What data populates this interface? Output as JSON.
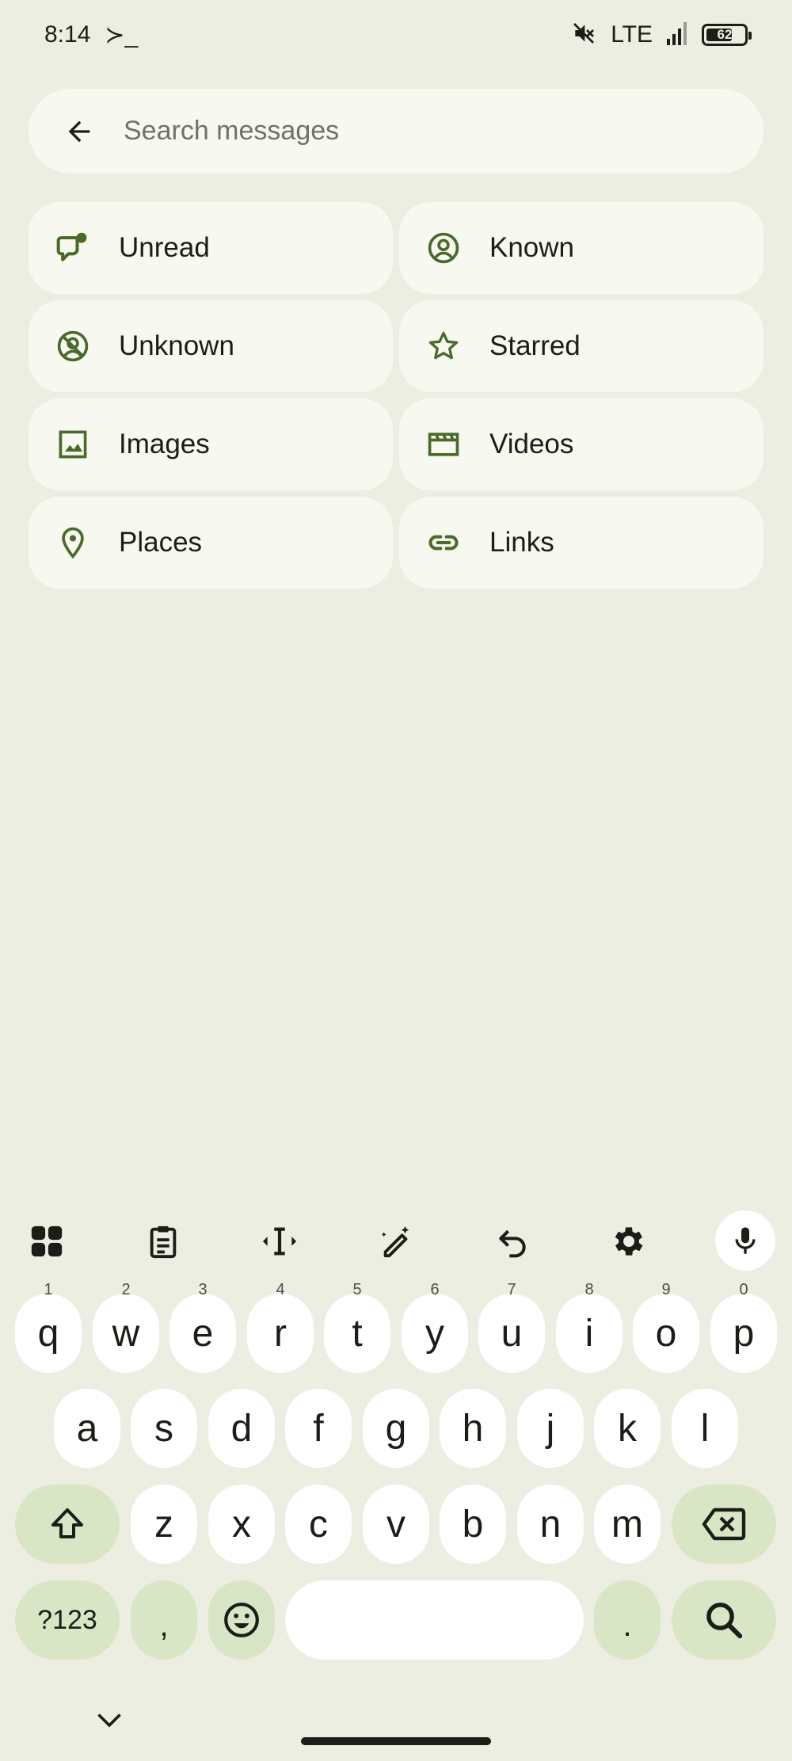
{
  "status_bar": {
    "time": "8:14",
    "terminal_glyph": "≻_",
    "network": "LTE",
    "battery": "62"
  },
  "search": {
    "placeholder": "Search messages"
  },
  "filters": [
    {
      "label": "Unread",
      "icon": "unread-chat-icon"
    },
    {
      "label": "Known",
      "icon": "person-circle-icon"
    },
    {
      "label": "Unknown",
      "icon": "unknown-person-icon"
    },
    {
      "label": "Starred",
      "icon": "star-icon"
    },
    {
      "label": "Images",
      "icon": "image-icon"
    },
    {
      "label": "Videos",
      "icon": "video-clapper-icon"
    },
    {
      "label": "Places",
      "icon": "location-pin-icon"
    },
    {
      "label": "Links",
      "icon": "link-icon"
    }
  ],
  "keyboard": {
    "row1": [
      {
        "k": "q",
        "n": "1"
      },
      {
        "k": "w",
        "n": "2"
      },
      {
        "k": "e",
        "n": "3"
      },
      {
        "k": "r",
        "n": "4"
      },
      {
        "k": "t",
        "n": "5"
      },
      {
        "k": "y",
        "n": "6"
      },
      {
        "k": "u",
        "n": "7"
      },
      {
        "k": "i",
        "n": "8"
      },
      {
        "k": "o",
        "n": "9"
      },
      {
        "k": "p",
        "n": "0"
      }
    ],
    "row2": [
      "a",
      "s",
      "d",
      "f",
      "g",
      "h",
      "j",
      "k",
      "l"
    ],
    "row3": [
      "z",
      "x",
      "c",
      "v",
      "b",
      "n",
      "m"
    ],
    "symbols_label": "?123",
    "comma": ",",
    "period": "."
  },
  "colors": {
    "background": "#eceee2",
    "chip": "#f7f8ef",
    "accent_icon": "#4a6a2a",
    "func_key": "#d9e6c6"
  }
}
